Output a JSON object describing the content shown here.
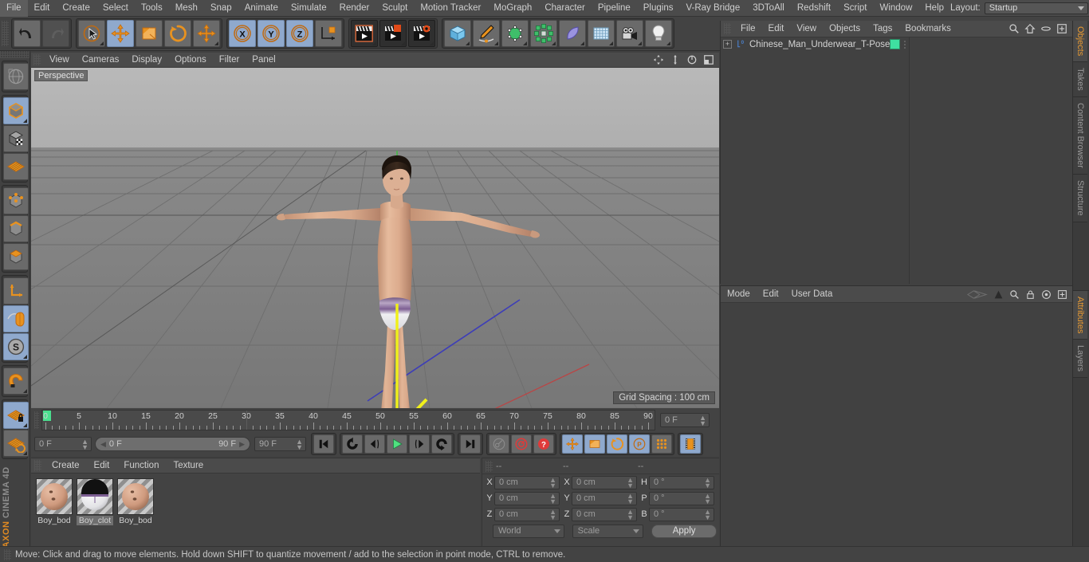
{
  "app": {
    "brand_maxon": "MAXON",
    "brand_product": "CINEMA 4D"
  },
  "menubar": {
    "items": [
      "File",
      "Edit",
      "Create",
      "Select",
      "Tools",
      "Mesh",
      "Snap",
      "Animate",
      "Simulate",
      "Render",
      "Sculpt",
      "Motion Tracker",
      "MoGraph",
      "Character",
      "Pipeline",
      "Plugins",
      "V-Ray Bridge",
      "3DToAll",
      "Redshift",
      "Script",
      "Window",
      "Help"
    ],
    "layout_label": "Layout:",
    "layout_value": "Startup",
    "search_icon": "search-icon",
    "home_icon": "home-icon",
    "capsule_icon": "capsule-icon",
    "plus_icon": "plus-box-icon"
  },
  "toolbar": {
    "groups": [
      {
        "name": "history",
        "buttons": [
          {
            "icon": "undo-icon",
            "label": "Undo",
            "active": false,
            "disabled": false
          },
          {
            "icon": "redo-icon",
            "label": "Redo",
            "active": false,
            "disabled": true
          }
        ]
      },
      {
        "name": "transform-tools",
        "buttons": [
          {
            "icon": "select-cursor-icon",
            "label": "Live Selection",
            "active": false
          },
          {
            "icon": "move-icon",
            "label": "Move",
            "active": true
          },
          {
            "icon": "scale-icon",
            "label": "Scale",
            "active": false
          },
          {
            "icon": "rotate-icon",
            "label": "Rotate",
            "active": false
          },
          {
            "icon": "move-axis-icon",
            "label": "Move (dupe)",
            "active": false
          }
        ]
      },
      {
        "name": "axis-locks",
        "buttons": [
          {
            "icon": "x-axis-icon",
            "label": "X",
            "active": true
          },
          {
            "icon": "y-axis-icon",
            "label": "Y",
            "active": true
          },
          {
            "icon": "z-axis-icon",
            "label": "Z",
            "active": true
          },
          {
            "icon": "world-axis-icon",
            "label": "World / Object",
            "active": false
          }
        ]
      },
      {
        "name": "render",
        "buttons": [
          {
            "icon": "render-view-icon",
            "label": "Render View",
            "active": false
          },
          {
            "icon": "render-region-icon",
            "label": "Render to Picture Viewer",
            "active": false
          },
          {
            "icon": "render-settings-icon",
            "label": "Render Settings",
            "active": false
          }
        ]
      },
      {
        "name": "create-objects",
        "buttons": [
          {
            "icon": "cube-icon",
            "label": "Add Cube Object",
            "active": false
          },
          {
            "icon": "pen-spline-icon",
            "label": "Add Spline",
            "active": false
          },
          {
            "icon": "nurbs-icon",
            "label": "Add Generator",
            "active": false
          },
          {
            "icon": "mograph-icon",
            "label": "Add MoGraph",
            "active": false
          },
          {
            "icon": "deformer-icon",
            "label": "Add Deformer",
            "active": false
          },
          {
            "icon": "scene-floor-icon",
            "label": "Add Scene Object",
            "active": false
          },
          {
            "icon": "camera-icon",
            "label": "Add Camera",
            "active": false
          },
          {
            "icon": "light-icon",
            "label": "Add Light",
            "active": false
          }
        ]
      }
    ]
  },
  "left_rail": {
    "groups": [
      [
        {
          "icon": "texture-axis-icon",
          "label": "Texture Axis",
          "active": false
        }
      ],
      [
        {
          "icon": "model-mode-icon",
          "label": "Model Mode",
          "active": true
        },
        {
          "icon": "texture-mode-icon",
          "label": "Texture Mode",
          "active": false
        },
        {
          "icon": "workplane-icon",
          "label": "Workplane",
          "active": false
        }
      ],
      [
        {
          "icon": "point-mode-icon",
          "label": "Points",
          "active": false
        },
        {
          "icon": "edge-mode-icon",
          "label": "Edges",
          "active": false
        },
        {
          "icon": "polygon-mode-icon",
          "label": "Polygons",
          "active": false
        }
      ],
      [
        {
          "icon": "object-axis-icon",
          "label": "Enable Axis",
          "active": false
        },
        {
          "icon": "viewport-solo-icon",
          "label": "Viewport Solo",
          "active": true
        },
        {
          "icon": "soft-selection-icon",
          "label": "Soft Selection",
          "active": true
        }
      ],
      [
        {
          "icon": "magnet-icon",
          "label": "Magnet",
          "active": false
        }
      ],
      [
        {
          "icon": "workplane-lock-icon",
          "label": "Lock Workplane",
          "active": true
        },
        {
          "icon": "workplane-align-icon",
          "label": "Align Workplane",
          "active": false
        }
      ]
    ]
  },
  "viewport": {
    "menu": [
      "View",
      "Cameras",
      "Display",
      "Options",
      "Filter",
      "Panel"
    ],
    "camera_label": "Perspective",
    "grid_spacing": "Grid Spacing : 100 cm",
    "nav_icons": [
      "pan-icon",
      "dolly-icon",
      "orbit-icon",
      "maximize-icon"
    ],
    "scene": {
      "object_label": "Chinese_Man_Underwear_T-Pose",
      "background_color": "#7b7b7b",
      "grid_line_color": "#6a6a6a",
      "axis_colors": {
        "x": "#d34040",
        "y": "#4ac14a",
        "z": "#4a4ad3",
        "selected": "#f2f21a"
      }
    }
  },
  "timeline": {
    "min_frame": 0,
    "max_frame": 90,
    "tick_step": 5,
    "labels": [
      "0",
      "5",
      "10",
      "15",
      "20",
      "25",
      "30",
      "35",
      "40",
      "45",
      "50",
      "55",
      "60",
      "65",
      "70",
      "75",
      "80",
      "85",
      "90"
    ],
    "current_frame_field": "0 F",
    "current_frame_field_2": "0 F",
    "range_start": "0 F",
    "range_end": "90 F",
    "end_frame_field": "90 F",
    "playhead_frame": 0,
    "transport": [
      {
        "icon": "goto-start-icon",
        "label": "Go to Start",
        "active": false
      },
      {
        "icon": "rewind-icon",
        "label": "Play Backwards",
        "active": false
      },
      {
        "icon": "step-back-icon",
        "label": "Previous Frame",
        "active": false
      },
      {
        "icon": "play-icon",
        "label": "Play Forwards",
        "active": false
      },
      {
        "icon": "step-forward-icon",
        "label": "Next Frame",
        "active": false
      },
      {
        "icon": "loop-icon",
        "label": "Loop",
        "active": false
      },
      {
        "icon": "goto-end-icon",
        "label": "Go to End",
        "active": false
      }
    ],
    "keys": [
      {
        "icon": "autokey-icon",
        "label": "Autokeying",
        "active": false
      },
      {
        "icon": "record-icon",
        "label": "Record Active Objects",
        "active": false
      },
      {
        "icon": "keyframe-select-icon",
        "label": "Keyframe Selection",
        "active": false
      }
    ],
    "record_toggles": [
      {
        "icon": "position-key-icon",
        "label": "Position",
        "active": true
      },
      {
        "icon": "scale-key-icon",
        "label": "Scale",
        "active": true
      },
      {
        "icon": "rotation-key-icon",
        "label": "Rotation",
        "active": true
      },
      {
        "icon": "param-key-icon",
        "label": "Parameter",
        "active": true
      },
      {
        "icon": "pla-key-icon",
        "label": "Point Level Animation",
        "active": false
      },
      {
        "icon": "timeline-icon",
        "label": "Timeline",
        "active": true
      }
    ]
  },
  "material_manager": {
    "menu": [
      "Create",
      "Edit",
      "Function",
      "Texture"
    ],
    "materials": [
      {
        "name": "Boy_bod",
        "icon": "material-sphere-icon",
        "selected": false,
        "kind": "skin"
      },
      {
        "name": "Boy_clot",
        "icon": "material-sphere-icon",
        "selected": true,
        "kind": "cloth"
      },
      {
        "name": "Boy_bod",
        "icon": "material-sphere-icon",
        "selected": false,
        "kind": "skin"
      }
    ]
  },
  "coordinates": {
    "headers": [
      "--",
      "--",
      "--"
    ],
    "rows": [
      {
        "pos_label": "X",
        "pos_value": "0 cm",
        "size_label": "X",
        "size_value": "0 cm",
        "rot_label": "H",
        "rot_value": "0 °"
      },
      {
        "pos_label": "Y",
        "pos_value": "0 cm",
        "size_label": "Y",
        "size_value": "0 cm",
        "rot_label": "P",
        "rot_value": "0 °"
      },
      {
        "pos_label": "Z",
        "pos_value": "0 cm",
        "size_label": "Z",
        "size_value": "0 cm",
        "rot_label": "B",
        "rot_value": "0 °"
      }
    ],
    "system_dropdown": "World",
    "mode_dropdown": "Scale",
    "apply_button": "Apply"
  },
  "object_manager": {
    "menu": [
      "File",
      "Edit",
      "View",
      "Objects",
      "Tags",
      "Bookmarks"
    ],
    "icons": [
      "search-icon",
      "home-icon",
      "capsule-icon",
      "plus-box-icon"
    ],
    "objects": [
      {
        "name": "Chinese_Man_Underwear_T-Pose",
        "expander": "+",
        "icon": "null-object-icon",
        "tag_color": "#3fe0a0"
      }
    ]
  },
  "attributes_manager": {
    "menu": [
      "Mode",
      "Edit",
      "User Data"
    ],
    "icons": [
      "interface-icon",
      "arrow-up-icon",
      "search-icon",
      "lock-icon",
      "target-icon",
      "plus-box-icon"
    ]
  },
  "right_tabs": [
    {
      "label": "Objects",
      "active": true
    },
    {
      "label": "Takes",
      "active": false
    },
    {
      "label": "Content Browser",
      "active": false
    },
    {
      "label": "Structure",
      "active": false
    },
    {
      "label": "Attributes",
      "active": true
    },
    {
      "label": "Layers",
      "active": false
    }
  ],
  "statusbar": {
    "text": "Move: Click and drag to move elements. Hold down SHIFT to quantize movement / add to the selection in point mode, CTRL to remove."
  }
}
